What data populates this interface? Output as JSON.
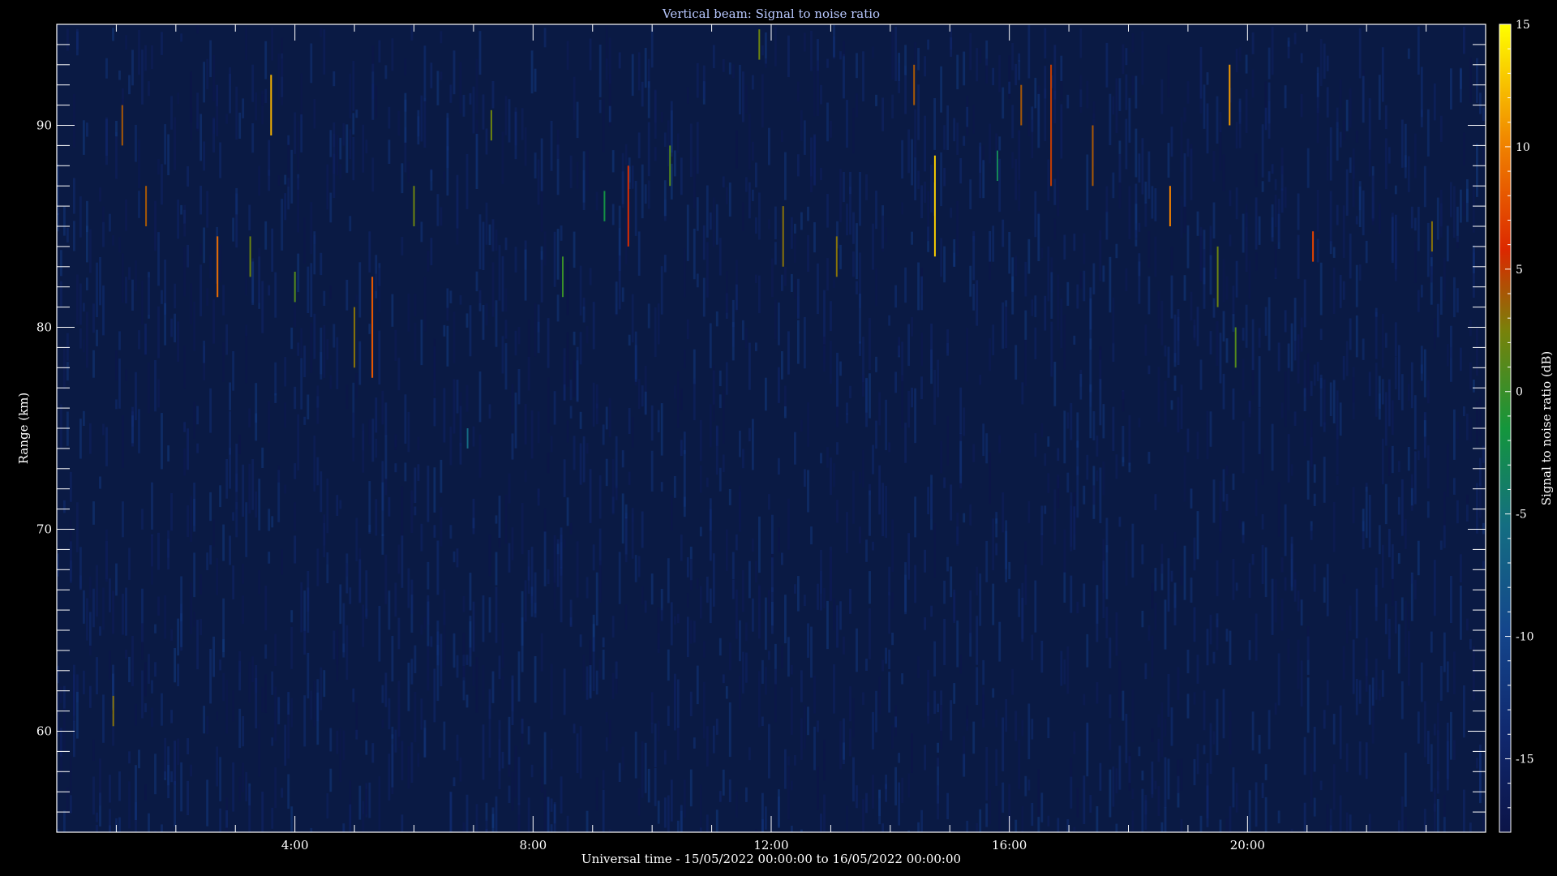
{
  "chart_data": {
    "type": "heatmap",
    "title": "Vertical beam: Signal to noise ratio",
    "xlabel": "Universal time - 15/05/2022 00:00:00 to 16/05/2022 00:00:00",
    "ylabel": "Range (km)",
    "xlim_hours": [
      0,
      24
    ],
    "ylim": [
      55,
      95
    ],
    "x_ticks": [
      {
        "hour": 4,
        "label": "4:00"
      },
      {
        "hour": 8,
        "label": "8:00"
      },
      {
        "hour": 12,
        "label": "12:00"
      },
      {
        "hour": 16,
        "label": "16:00"
      },
      {
        "hour": 20,
        "label": "20:00"
      }
    ],
    "y_ticks": [
      {
        "value": 60,
        "label": "60"
      },
      {
        "value": 70,
        "label": "70"
      },
      {
        "value": 80,
        "label": "80"
      },
      {
        "value": 90,
        "label": "90"
      }
    ],
    "colorbar": {
      "label": "Signal to noise ratio (dB)",
      "range": [
        -18,
        15
      ],
      "ticks": [
        {
          "value": 15,
          "label": "15"
        },
        {
          "value": 10,
          "label": "10"
        },
        {
          "value": 5,
          "label": "5"
        },
        {
          "value": 0,
          "label": "0"
        },
        {
          "value": -5,
          "label": "-5"
        },
        {
          "value": -10,
          "label": "-10"
        },
        {
          "value": -15,
          "label": "-15"
        }
      ]
    },
    "background_level_db": -16,
    "echoes": [
      {
        "hour": 3.6,
        "range_km": 91,
        "length_km": 3,
        "snr_db": 12
      },
      {
        "hour": 2.7,
        "range_km": 83,
        "length_km": 3,
        "snr_db": 9
      },
      {
        "hour": 5.3,
        "range_km": 80,
        "length_km": 5,
        "snr_db": 8
      },
      {
        "hour": 5.0,
        "range_km": 79.5,
        "length_km": 3,
        "snr_db": 3
      },
      {
        "hour": 1.5,
        "range_km": 86,
        "length_km": 2,
        "snr_db": 4
      },
      {
        "hour": 3.25,
        "range_km": 83.5,
        "length_km": 2,
        "snr_db": 2
      },
      {
        "hour": 6.0,
        "range_km": 86,
        "length_km": 2,
        "snr_db": 2
      },
      {
        "hour": 7.3,
        "range_km": 90,
        "length_km": 1.5,
        "snr_db": 2
      },
      {
        "hour": 6.9,
        "range_km": 74.5,
        "length_km": 1,
        "snr_db": -6
      },
      {
        "hour": 0.95,
        "range_km": 61,
        "length_km": 1.5,
        "snr_db": 3
      },
      {
        "hour": 9.6,
        "range_km": 86,
        "length_km": 4,
        "snr_db": 6
      },
      {
        "hour": 10.3,
        "range_km": 88,
        "length_km": 2,
        "snr_db": 1
      },
      {
        "hour": 11.8,
        "range_km": 94,
        "length_km": 1.5,
        "snr_db": 2
      },
      {
        "hour": 12.2,
        "range_km": 84.5,
        "length_km": 3,
        "snr_db": 3
      },
      {
        "hour": 13.1,
        "range_km": 83.5,
        "length_km": 2,
        "snr_db": 3
      },
      {
        "hour": 14.75,
        "range_km": 86,
        "length_km": 5,
        "snr_db": 13
      },
      {
        "hour": 14.4,
        "range_km": 92,
        "length_km": 2,
        "snr_db": 4
      },
      {
        "hour": 16.2,
        "range_km": 91,
        "length_km": 2,
        "snr_db": 4
      },
      {
        "hour": 16.7,
        "range_km": 90,
        "length_km": 6,
        "snr_db": 5
      },
      {
        "hour": 17.4,
        "range_km": 88.5,
        "length_km": 3,
        "snr_db": 4
      },
      {
        "hour": 18.7,
        "range_km": 86,
        "length_km": 2,
        "snr_db": 10
      },
      {
        "hour": 19.5,
        "range_km": 82.5,
        "length_km": 3,
        "snr_db": 2
      },
      {
        "hour": 19.7,
        "range_km": 91.5,
        "length_km": 3,
        "snr_db": 11
      },
      {
        "hour": 19.8,
        "range_km": 79,
        "length_km": 2,
        "snr_db": 1
      },
      {
        "hour": 21.1,
        "range_km": 84,
        "length_km": 1.5,
        "snr_db": 7
      },
      {
        "hour": 23.1,
        "range_km": 84.5,
        "length_km": 1.5,
        "snr_db": 3
      },
      {
        "hour": 1.1,
        "range_km": 90,
        "length_km": 2,
        "snr_db": 4
      },
      {
        "hour": 4.0,
        "range_km": 82,
        "length_km": 1.5,
        "snr_db": 1
      },
      {
        "hour": 8.5,
        "range_km": 82.5,
        "length_km": 2,
        "snr_db": 0
      },
      {
        "hour": 9.2,
        "range_km": 86,
        "length_km": 1.5,
        "snr_db": -2
      },
      {
        "hour": 15.8,
        "range_km": 88,
        "length_km": 1.5,
        "snr_db": -3
      }
    ]
  }
}
